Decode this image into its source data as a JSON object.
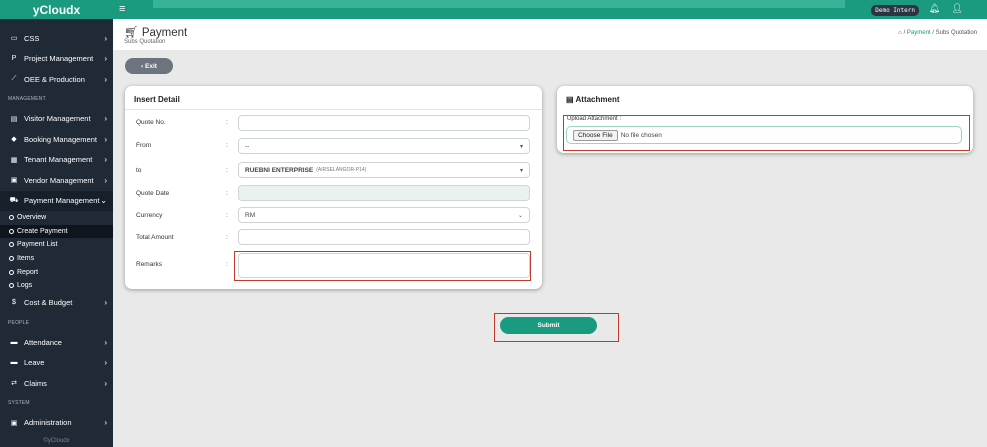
{
  "app": {
    "logo": "yCloudx"
  },
  "sidebar": {
    "items_top": [
      {
        "icon": "monitor-icon",
        "glyph": "▭",
        "label": "CSS"
      },
      {
        "icon": "project-icon",
        "glyph": "P",
        "label": "Project Management"
      },
      {
        "icon": "chart-icon",
        "glyph": "⟋",
        "label": "OEE & Production"
      }
    ],
    "section_management": "MANAGEMENT",
    "items_management": [
      {
        "icon": "id-card-icon",
        "glyph": "▤",
        "label": "Visitor Management"
      },
      {
        "icon": "tag-icon",
        "glyph": "◆",
        "label": "Booking Management"
      },
      {
        "icon": "building-icon",
        "glyph": "▦",
        "label": "Tenant Management"
      },
      {
        "icon": "vendor-icon",
        "glyph": "▣",
        "label": "Vendor Management"
      },
      {
        "icon": "cart-icon",
        "glyph": "⛟",
        "label": "Payment Management"
      }
    ],
    "payment_sub": [
      "Overview",
      "Create Payment",
      "Payment List",
      "Items",
      "Report",
      "Logs"
    ],
    "cost_item": {
      "icon": "dollar-icon",
      "glyph": "$",
      "label": "Cost & Budget"
    },
    "section_people": "PEOPLE",
    "items_people": [
      {
        "icon": "attendance-icon",
        "glyph": "▬",
        "label": "Attendance"
      },
      {
        "icon": "leave-icon",
        "glyph": "▬",
        "label": "Leave"
      },
      {
        "icon": "claims-icon",
        "glyph": "⇄",
        "label": "Claims"
      }
    ],
    "section_system": "SYSTEM",
    "admin_item": {
      "icon": "admin-icon",
      "glyph": "▣",
      "label": "Administration"
    },
    "footer": "©yCloudx"
  },
  "topbar": {
    "badge": "Demo Intern"
  },
  "header": {
    "title": "Payment",
    "subtitle": "Subs Quotation",
    "breadcrumb": {
      "link": "Payment",
      "sep": "/",
      "current": "Subs Quotation"
    }
  },
  "exit_label": "Exit",
  "insert": {
    "title": "Insert Detail",
    "fields": [
      {
        "label": "Quote No.",
        "value": "",
        "type": "text"
      },
      {
        "label": "From",
        "value": "--",
        "type": "select"
      },
      {
        "label": "to",
        "value": "RUEBNI ENTERPRISE",
        "sub": "(AIRSELANGOR-P14)",
        "type": "select"
      },
      {
        "label": "Quote Date",
        "value": "",
        "type": "disabled"
      },
      {
        "label": "Currency",
        "value": "RM",
        "type": "select2"
      },
      {
        "label": "Total Amount",
        "value": "",
        "type": "text"
      },
      {
        "label": "Remarks",
        "value": "",
        "type": "textarea"
      }
    ]
  },
  "attachment": {
    "title": "Attachment",
    "label": "Upload Attachment :",
    "button": "Choose File",
    "status": "No file chosen"
  },
  "submit_label": "Submit",
  "colors": {
    "accent": "#1a9a7f",
    "sidebar": "#1f2a36",
    "highlight": "#c0392b"
  }
}
